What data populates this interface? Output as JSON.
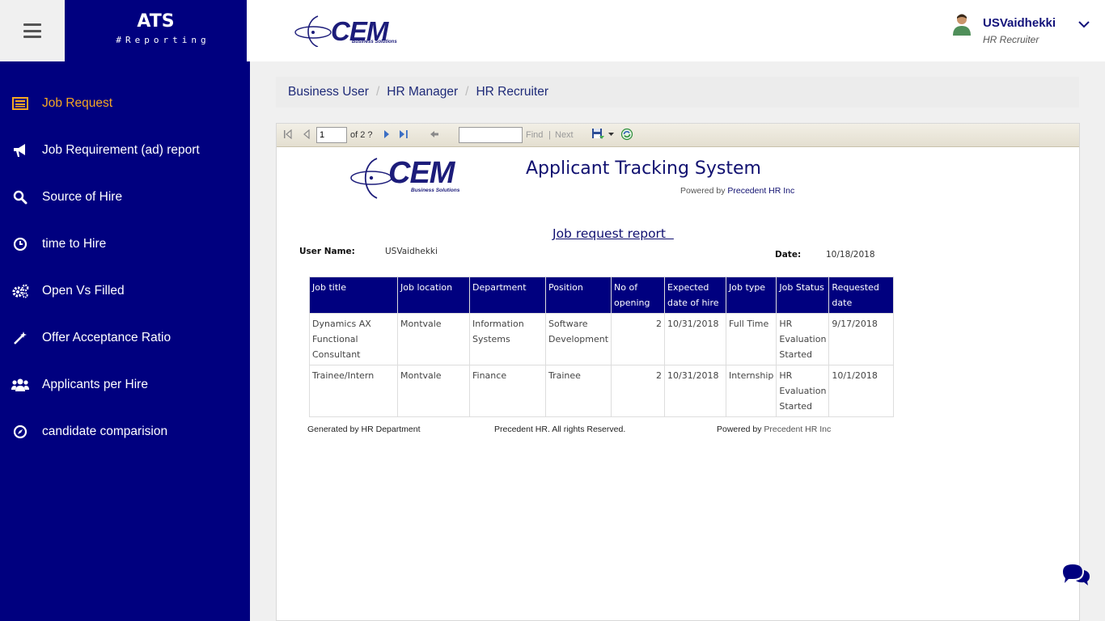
{
  "brand": {
    "title": "ATS",
    "subtitle": "#Reporting"
  },
  "header": {
    "logo_text": "CEM",
    "logo_sub": "Business Solutions",
    "user_name": "USVaidhekki",
    "user_role": "HR Recruiter"
  },
  "sidebar": {
    "items": [
      {
        "label": "Job Request",
        "icon": "list-icon",
        "active": true
      },
      {
        "label": "Job Requirement (ad) report",
        "icon": "megaphone-icon"
      },
      {
        "label": "Source of Hire",
        "icon": "search-icon"
      },
      {
        "label": "time to Hire",
        "icon": "clock-icon"
      },
      {
        "label": "Open Vs Filled",
        "icon": "gears-icon"
      },
      {
        "label": "Offer Acceptance Ratio",
        "icon": "magic-wand-icon"
      },
      {
        "label": "Applicants per Hire",
        "icon": "users-icon"
      },
      {
        "label": "candidate comparision",
        "icon": "compass-icon"
      }
    ]
  },
  "breadcrumb": [
    "Business User",
    "HR Manager",
    "HR Recruiter"
  ],
  "toolbar": {
    "page_value": "1",
    "page_of": "of 2 ?",
    "find_label": "Find",
    "separator": "|",
    "next_label": "Next"
  },
  "report": {
    "logo_text": "CEM",
    "logo_sub": "Business Solutions",
    "title": "Applicant Tracking System",
    "powered_prefix": "Powered by ",
    "powered_by": "Precedent HR Inc",
    "subtitle": "Job request report  ",
    "user_name_label": "User Name:",
    "user_name": "USVaidhekki",
    "date_label": "Date:",
    "date": "10/18/2018",
    "columns": [
      "Job title",
      "Job location",
      "Department",
      "Position",
      "No of opening",
      "Expected date of hire",
      "Job type",
      "Job Status",
      "Requested date"
    ],
    "rows": [
      [
        "Dynamics AX Functional Consultant",
        "Montvale",
        "Information Systems",
        "Software Development",
        "2",
        "10/31/2018",
        "Full Time",
        "HR Evaluation Started",
        "9/17/2018"
      ],
      [
        "Trainee/Intern",
        "Montvale",
        "Finance",
        "Trainee",
        "2",
        "10/31/2018",
        "Internship",
        "HR Evaluation Started",
        "10/1/2018"
      ]
    ],
    "footer": {
      "generated": "Generated by HR Department",
      "rights": "Precedent HR. All rights Reserved.",
      "powered_prefix": "Powered by ",
      "powered_by": "Precedent HR Inc"
    }
  },
  "colors": {
    "sidebar": "#00007f",
    "active": "#f5a623",
    "header_text": "#12127a"
  }
}
